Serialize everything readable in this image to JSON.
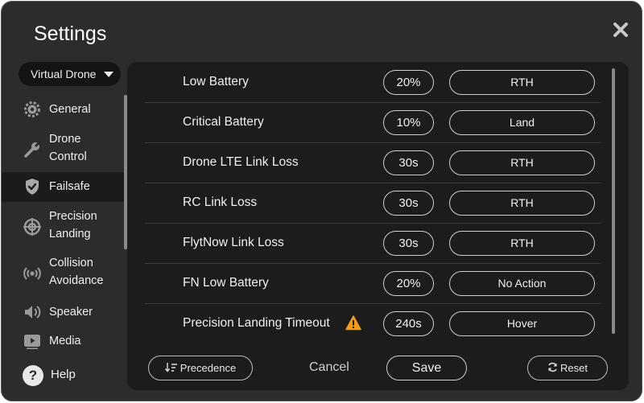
{
  "window": {
    "title": "Settings"
  },
  "vehicle_selector": {
    "value": "Virtual Drone"
  },
  "nav": {
    "items": [
      {
        "label": "General",
        "icon": "gear-icon"
      },
      {
        "label": "Drone Control",
        "line1": "Drone",
        "line2": "Control",
        "icon": "wrench-icon"
      },
      {
        "label": "Failsafe",
        "icon": "shield-check-icon",
        "active": true
      },
      {
        "label": "Precision Landing",
        "line1": "Precision",
        "line2": "Landing",
        "icon": "crosshair-icon"
      },
      {
        "label": "Collision Avoidance",
        "line1": "Collision",
        "line2": "Avoidance",
        "icon": "broadcast-icon"
      },
      {
        "label": "Speaker",
        "icon": "speaker-icon"
      },
      {
        "label": "Media",
        "icon": "play-icon"
      }
    ],
    "help_label": "Help"
  },
  "failsafe": {
    "rows": [
      {
        "name": "Low Battery",
        "value": "20%",
        "action": "RTH"
      },
      {
        "name": "Critical Battery",
        "value": "10%",
        "action": "Land"
      },
      {
        "name": "Drone LTE Link Loss",
        "value": "30s",
        "action": "RTH"
      },
      {
        "name": "RC Link Loss",
        "value": "30s",
        "action": "RTH"
      },
      {
        "name": "FlytNow Link Loss",
        "value": "30s",
        "action": "RTH"
      },
      {
        "name": "FN Low Battery",
        "value": "20%",
        "action": "No Action"
      },
      {
        "name": "Precision Landing Timeout",
        "value": "240s",
        "action": "Hover",
        "warning": true
      }
    ]
  },
  "footer": {
    "precedence_label": "Precedence",
    "cancel_label": "Cancel",
    "save_label": "Save",
    "reset_label": "Reset"
  },
  "colors": {
    "window_bg": "#2c2c2c",
    "panel_bg": "#1c1c1c",
    "warning": "#f39c12",
    "text": "#f0f0f0"
  }
}
